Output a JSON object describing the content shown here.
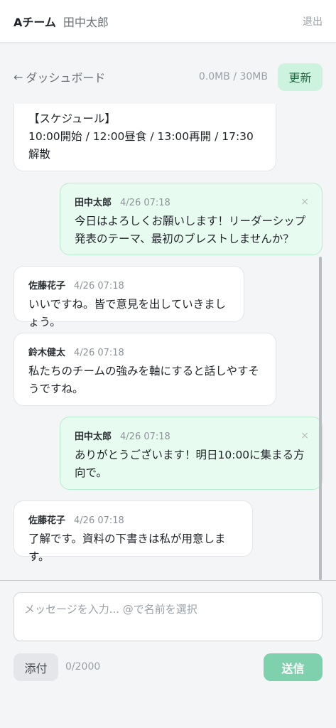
{
  "header": {
    "team": "Aチーム",
    "user": "田中太郎",
    "logout": "退出"
  },
  "toolbar": {
    "back_arrow": "←",
    "back_label": "ダッシュボード",
    "storage": "0.0MB / 30MB",
    "refresh": "更新"
  },
  "messages": [
    {
      "author": "",
      "time": "",
      "text": "【スケジュール】\n10:00開始 / 12:00昼食 / 13:00再開 / 17:30解散",
      "mine": false
    },
    {
      "author": "田中太郎",
      "time": "4/26 07:18",
      "text": "今日はよろしくお願いします！リーダーシップ発表のテーマ、最初のブレストしませんか？",
      "mine": true,
      "close": "×"
    },
    {
      "author": "佐藤花子",
      "time": "4/26 07:18",
      "text": "いいですね。皆で意見を出していきましょう。",
      "mine": false
    },
    {
      "author": "鈴木健太",
      "time": "4/26 07:18",
      "text": "私たちのチームの強みを軸にすると話しやすそうですね。",
      "mine": false
    },
    {
      "author": "田中太郎",
      "time": "4/26 07:18",
      "text": "ありがとうございます！明日10:00に集まる方向で。",
      "mine": true,
      "close": "×"
    },
    {
      "author": "佐藤花子",
      "time": "4/26 07:18",
      "text": "了解です。資料の下書きは私が用意します。",
      "mine": false
    }
  ],
  "composer": {
    "placeholder": "メッセージを入力... @で名前を選択",
    "value": "",
    "attach": "添付",
    "count": "0/2000",
    "send": "送信"
  },
  "colors": {
    "accent": "#7fd1ad",
    "mine_bubble": "#e8fbf1",
    "refresh_bg": "#cdf3df"
  }
}
